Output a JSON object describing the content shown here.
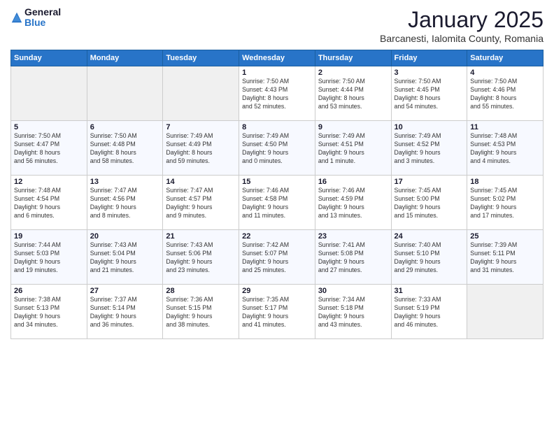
{
  "logo": {
    "general": "General",
    "blue": "Blue"
  },
  "header": {
    "title": "January 2025",
    "subtitle": "Barcanesti, Ialomita County, Romania"
  },
  "days_of_week": [
    "Sunday",
    "Monday",
    "Tuesday",
    "Wednesday",
    "Thursday",
    "Friday",
    "Saturday"
  ],
  "weeks": [
    [
      {
        "day": "",
        "info": ""
      },
      {
        "day": "",
        "info": ""
      },
      {
        "day": "",
        "info": ""
      },
      {
        "day": "1",
        "info": "Sunrise: 7:50 AM\nSunset: 4:43 PM\nDaylight: 8 hours\nand 52 minutes."
      },
      {
        "day": "2",
        "info": "Sunrise: 7:50 AM\nSunset: 4:44 PM\nDaylight: 8 hours\nand 53 minutes."
      },
      {
        "day": "3",
        "info": "Sunrise: 7:50 AM\nSunset: 4:45 PM\nDaylight: 8 hours\nand 54 minutes."
      },
      {
        "day": "4",
        "info": "Sunrise: 7:50 AM\nSunset: 4:46 PM\nDaylight: 8 hours\nand 55 minutes."
      }
    ],
    [
      {
        "day": "5",
        "info": "Sunrise: 7:50 AM\nSunset: 4:47 PM\nDaylight: 8 hours\nand 56 minutes."
      },
      {
        "day": "6",
        "info": "Sunrise: 7:50 AM\nSunset: 4:48 PM\nDaylight: 8 hours\nand 58 minutes."
      },
      {
        "day": "7",
        "info": "Sunrise: 7:49 AM\nSunset: 4:49 PM\nDaylight: 8 hours\nand 59 minutes."
      },
      {
        "day": "8",
        "info": "Sunrise: 7:49 AM\nSunset: 4:50 PM\nDaylight: 9 hours\nand 0 minutes."
      },
      {
        "day": "9",
        "info": "Sunrise: 7:49 AM\nSunset: 4:51 PM\nDaylight: 9 hours\nand 1 minute."
      },
      {
        "day": "10",
        "info": "Sunrise: 7:49 AM\nSunset: 4:52 PM\nDaylight: 9 hours\nand 3 minutes."
      },
      {
        "day": "11",
        "info": "Sunrise: 7:48 AM\nSunset: 4:53 PM\nDaylight: 9 hours\nand 4 minutes."
      }
    ],
    [
      {
        "day": "12",
        "info": "Sunrise: 7:48 AM\nSunset: 4:54 PM\nDaylight: 9 hours\nand 6 minutes."
      },
      {
        "day": "13",
        "info": "Sunrise: 7:47 AM\nSunset: 4:56 PM\nDaylight: 9 hours\nand 8 minutes."
      },
      {
        "day": "14",
        "info": "Sunrise: 7:47 AM\nSunset: 4:57 PM\nDaylight: 9 hours\nand 9 minutes."
      },
      {
        "day": "15",
        "info": "Sunrise: 7:46 AM\nSunset: 4:58 PM\nDaylight: 9 hours\nand 11 minutes."
      },
      {
        "day": "16",
        "info": "Sunrise: 7:46 AM\nSunset: 4:59 PM\nDaylight: 9 hours\nand 13 minutes."
      },
      {
        "day": "17",
        "info": "Sunrise: 7:45 AM\nSunset: 5:00 PM\nDaylight: 9 hours\nand 15 minutes."
      },
      {
        "day": "18",
        "info": "Sunrise: 7:45 AM\nSunset: 5:02 PM\nDaylight: 9 hours\nand 17 minutes."
      }
    ],
    [
      {
        "day": "19",
        "info": "Sunrise: 7:44 AM\nSunset: 5:03 PM\nDaylight: 9 hours\nand 19 minutes."
      },
      {
        "day": "20",
        "info": "Sunrise: 7:43 AM\nSunset: 5:04 PM\nDaylight: 9 hours\nand 21 minutes."
      },
      {
        "day": "21",
        "info": "Sunrise: 7:43 AM\nSunset: 5:06 PM\nDaylight: 9 hours\nand 23 minutes."
      },
      {
        "day": "22",
        "info": "Sunrise: 7:42 AM\nSunset: 5:07 PM\nDaylight: 9 hours\nand 25 minutes."
      },
      {
        "day": "23",
        "info": "Sunrise: 7:41 AM\nSunset: 5:08 PM\nDaylight: 9 hours\nand 27 minutes."
      },
      {
        "day": "24",
        "info": "Sunrise: 7:40 AM\nSunset: 5:10 PM\nDaylight: 9 hours\nand 29 minutes."
      },
      {
        "day": "25",
        "info": "Sunrise: 7:39 AM\nSunset: 5:11 PM\nDaylight: 9 hours\nand 31 minutes."
      }
    ],
    [
      {
        "day": "26",
        "info": "Sunrise: 7:38 AM\nSunset: 5:13 PM\nDaylight: 9 hours\nand 34 minutes."
      },
      {
        "day": "27",
        "info": "Sunrise: 7:37 AM\nSunset: 5:14 PM\nDaylight: 9 hours\nand 36 minutes."
      },
      {
        "day": "28",
        "info": "Sunrise: 7:36 AM\nSunset: 5:15 PM\nDaylight: 9 hours\nand 38 minutes."
      },
      {
        "day": "29",
        "info": "Sunrise: 7:35 AM\nSunset: 5:17 PM\nDaylight: 9 hours\nand 41 minutes."
      },
      {
        "day": "30",
        "info": "Sunrise: 7:34 AM\nSunset: 5:18 PM\nDaylight: 9 hours\nand 43 minutes."
      },
      {
        "day": "31",
        "info": "Sunrise: 7:33 AM\nSunset: 5:19 PM\nDaylight: 9 hours\nand 46 minutes."
      },
      {
        "day": "",
        "info": ""
      }
    ]
  ]
}
